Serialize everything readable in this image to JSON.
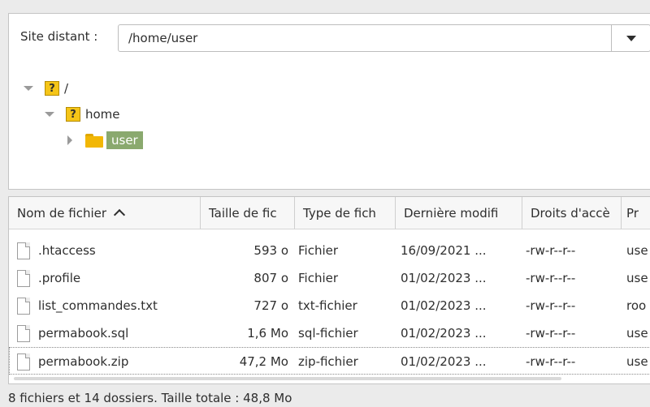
{
  "remote_site": {
    "label": "Site distant :",
    "path": "/home/user"
  },
  "tree": {
    "nodes": [
      {
        "label": "/",
        "icon": "question-folder-icon",
        "expanded": true
      },
      {
        "label": "home",
        "icon": "question-folder-icon",
        "expanded": true
      },
      {
        "label": "user",
        "icon": "folder-icon",
        "expanded": false,
        "selected": true
      }
    ]
  },
  "file_list": {
    "columns": [
      "Nom de fichier",
      "Taille de fic",
      "Type de fich",
      "Dernière modifi",
      "Droits d'accè",
      "Pr"
    ],
    "rows": [
      {
        "name": ".htaccess",
        "size": "593 o",
        "type": "Fichier",
        "modified": "16/09/2021 ...",
        "perms": "-rw-r--r--",
        "owner": "use"
      },
      {
        "name": ".profile",
        "size": "807 o",
        "type": "Fichier",
        "modified": "01/02/2023 ...",
        "perms": "-rw-r--r--",
        "owner": "use"
      },
      {
        "name": "list_commandes.txt",
        "size": "727 o",
        "type": "txt-fichier",
        "modified": "01/02/2023 ...",
        "perms": "-rw-r--r--",
        "owner": "roo"
      },
      {
        "name": "permabook.sql",
        "size": "1,6 Mo",
        "type": "sql-fichier",
        "modified": "01/02/2023 ...",
        "perms": "-rw-r--r--",
        "owner": "use"
      },
      {
        "name": "permabook.zip",
        "size": "47,2 Mo",
        "type": "zip-fichier",
        "modified": "01/02/2023 ...",
        "perms": "-rw-r--r--",
        "owner": "use"
      }
    ]
  },
  "status_bar": {
    "text": "8 fichiers et 14 dossiers. Taille totale : 48,8 Mo"
  },
  "colors": {
    "selection": "#8aa96e",
    "folder": "#f2b705",
    "unknown_folder": "#f5c518"
  }
}
